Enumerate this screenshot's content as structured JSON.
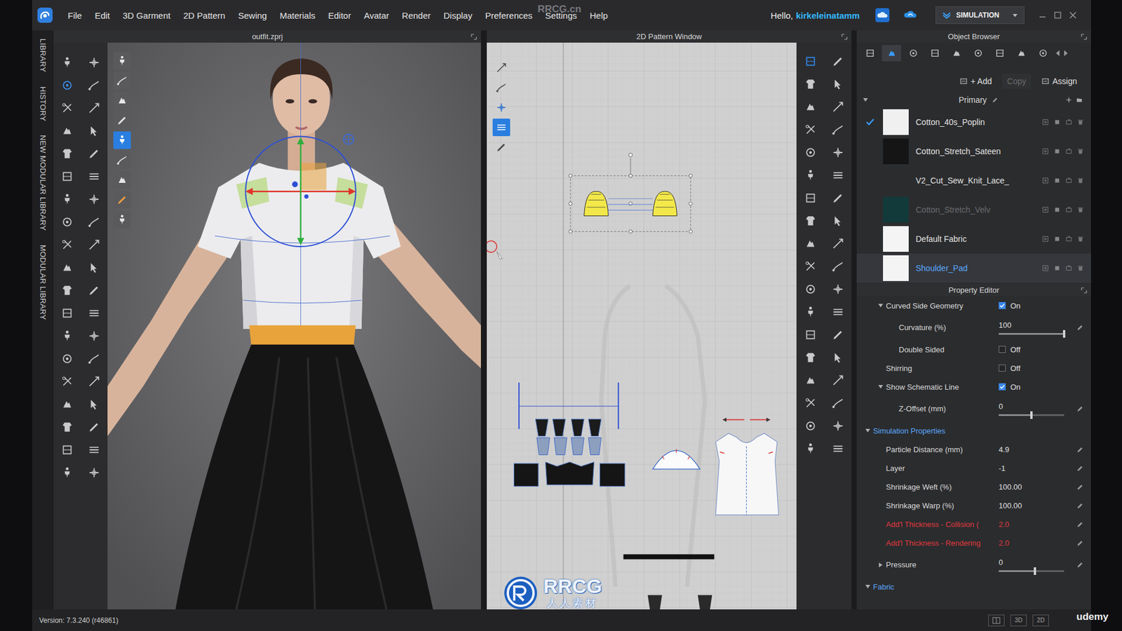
{
  "menu_bar": {
    "items": [
      "File",
      "Edit",
      "3D Garment",
      "2D Pattern",
      "Sewing",
      "Materials",
      "Editor",
      "Avatar",
      "Render",
      "Display",
      "Preferences",
      "Settings",
      "Help"
    ],
    "greeting": "Hello,",
    "user": "kirkeleinatamm",
    "mode": "SIMULATION"
  },
  "side_tabs": [
    "LIBRARY",
    "HISTORY",
    "NEW MODULAR LIBRARY",
    "MODULAR LIBRARY"
  ],
  "viewport_3d": {
    "title": "outfit.zprj",
    "tools": [
      {
        "selected": false
      },
      {
        "selected": false
      },
      {
        "selected": false
      },
      {
        "selected": false
      },
      {
        "selected": true
      },
      {
        "selected": false
      },
      {
        "selected": false
      },
      {
        "selected": false
      },
      {
        "selected": false
      }
    ]
  },
  "pattern_window": {
    "title": "2D Pattern Window",
    "tools": [
      {
        "selected": false
      },
      {
        "selected": false
      },
      {
        "selected": false
      },
      {
        "selected": true
      },
      {
        "selected": false
      }
    ],
    "toolbar": [
      {
        "selected": true
      },
      {
        "selected": false
      },
      {
        "selected": false
      },
      {
        "selected": false
      },
      {
        "selected": false
      },
      {
        "selected": false
      },
      {
        "selected": false
      },
      {
        "selected": false
      },
      {
        "selected": false
      },
      {
        "selected": false
      },
      {
        "selected": false
      },
      {
        "selected": false
      },
      {
        "selected": false
      },
      {
        "selected": false
      },
      {
        "selected": false
      },
      {
        "selected": false
      },
      {
        "selected": false
      },
      {
        "selected": false
      },
      {
        "selected": false
      },
      {
        "selected": false
      },
      {
        "selected": false
      },
      {
        "selected": false
      },
      {
        "selected": false
      },
      {
        "selected": false
      },
      {
        "selected": false
      },
      {
        "selected": false
      },
      {
        "selected": false
      },
      {
        "selected": false
      },
      {
        "selected": false
      },
      {
        "selected": false
      },
      {
        "selected": false
      },
      {
        "selected": false
      },
      {
        "selected": false
      },
      {
        "selected": false
      },
      {
        "selected": false
      },
      {
        "selected": false
      }
    ]
  },
  "object_browser": {
    "title": "Object Browser",
    "tabs": [
      {
        "selected": false
      },
      {
        "selected": true
      },
      {
        "selected": false
      },
      {
        "selected": false
      },
      {
        "selected": false
      },
      {
        "selected": false
      },
      {
        "selected": false
      },
      {
        "selected": false
      },
      {
        "selected": false
      }
    ],
    "buttons": [
      {
        "label": "+ Add",
        "disabled": false
      },
      {
        "label": "Copy",
        "disabled": true
      },
      {
        "label": "Assign",
        "disabled": false
      }
    ],
    "group": "Primary",
    "group_expanded": true,
    "fabrics": [
      {
        "name": "Cotton_40s_Poplin",
        "color": "#f0f0f0",
        "applied": true,
        "selected": false,
        "disabled": false
      },
      {
        "name": "Cotton_Stretch_Sateen",
        "color": "#151515",
        "applied": false,
        "selected": false,
        "disabled": false
      },
      {
        "name": "V2_Cut_Sew_Knit_Lace_",
        "color": "#2b2c2e",
        "applied": false,
        "selected": false,
        "disabled": false
      },
      {
        "name": "Cotton_Stretch_Velv",
        "color": "#123a3a",
        "applied": false,
        "selected": false,
        "disabled": true
      },
      {
        "name": "Default Fabric",
        "color": "#f4f4f4",
        "applied": false,
        "selected": false,
        "disabled": false
      },
      {
        "name": "Shoulder_Pad",
        "color": "#f4f4f4",
        "applied": false,
        "selected": true,
        "disabled": false
      }
    ]
  },
  "property_editor": {
    "title": "Property Editor",
    "rows": [
      {
        "kind": "toggle",
        "label": "Curved Side Geometry",
        "checked": true,
        "value": "On",
        "has_arrow": true,
        "expanded": true,
        "depth": 1,
        "modified": false
      },
      {
        "kind": "slider",
        "label": "Curvature (%)",
        "value": "100",
        "level": 1,
        "has_arrow": false,
        "expanded": false,
        "depth": 2,
        "modified": false
      },
      {
        "kind": "toggle",
        "label": "Double Sided",
        "checked": false,
        "value": "Off",
        "has_arrow": false,
        "expanded": false,
        "depth": 2,
        "modified": false
      },
      {
        "kind": "toggle",
        "label": "Shirring",
        "checked": false,
        "value": "Off",
        "has_arrow": false,
        "expanded": false,
        "depth": 1,
        "modified": false
      },
      {
        "kind": "toggle",
        "label": "Show Schematic Line",
        "checked": true,
        "value": "On",
        "has_arrow": true,
        "expanded": true,
        "depth": 1,
        "modified": false
      },
      {
        "kind": "slider",
        "label": "Z-Offset (mm)",
        "value": "0",
        "level": 0.5,
        "has_arrow": false,
        "expanded": false,
        "depth": 2,
        "modified": false
      },
      {
        "kind": "section",
        "label": "Simulation Properties",
        "has_arrow": true,
        "expanded": true,
        "depth": 0,
        "modified": false
      },
      {
        "kind": "value",
        "label": "Particle Distance (mm)",
        "value": "4.9",
        "has_arrow": false,
        "expanded": false,
        "depth": 1,
        "modified": false
      },
      {
        "kind": "value",
        "label": "Layer",
        "value": "-1",
        "has_arrow": false,
        "expanded": false,
        "depth": 1,
        "modified": false
      },
      {
        "kind": "value",
        "label": "Shrinkage Weft (%)",
        "value": "100.00",
        "has_arrow": false,
        "expanded": false,
        "depth": 1,
        "modified": false
      },
      {
        "kind": "value",
        "label": "Shrinkage Warp (%)",
        "value": "100.00",
        "has_arrow": false,
        "expanded": false,
        "depth": 1,
        "modified": false
      },
      {
        "kind": "value",
        "label": "Add'l Thickness - Collision (",
        "value": "2.0",
        "has_arrow": false,
        "expanded": false,
        "depth": 1,
        "modified": true
      },
      {
        "kind": "value",
        "label": "Add'l Thickness - Rendering",
        "value": "2.0",
        "has_arrow": false,
        "expanded": false,
        "depth": 1,
        "modified": true
      },
      {
        "kind": "slider",
        "label": "Pressure",
        "value": "0",
        "level": 0.55,
        "has_arrow": true,
        "expanded": false,
        "depth": 1,
        "modified": false
      },
      {
        "kind": "section",
        "label": "Fabric",
        "has_arrow": true,
        "expanded": true,
        "depth": 0,
        "modified": false
      }
    ]
  },
  "status_bar": {
    "version": "Version: 7.3.240 (r46861)",
    "view_buttons": [
      "3D",
      "2D"
    ]
  },
  "watermarks": {
    "site": "RRCG.cn",
    "logo": "RRCG",
    "logo_sub": "人人素材",
    "course": "udemy"
  }
}
